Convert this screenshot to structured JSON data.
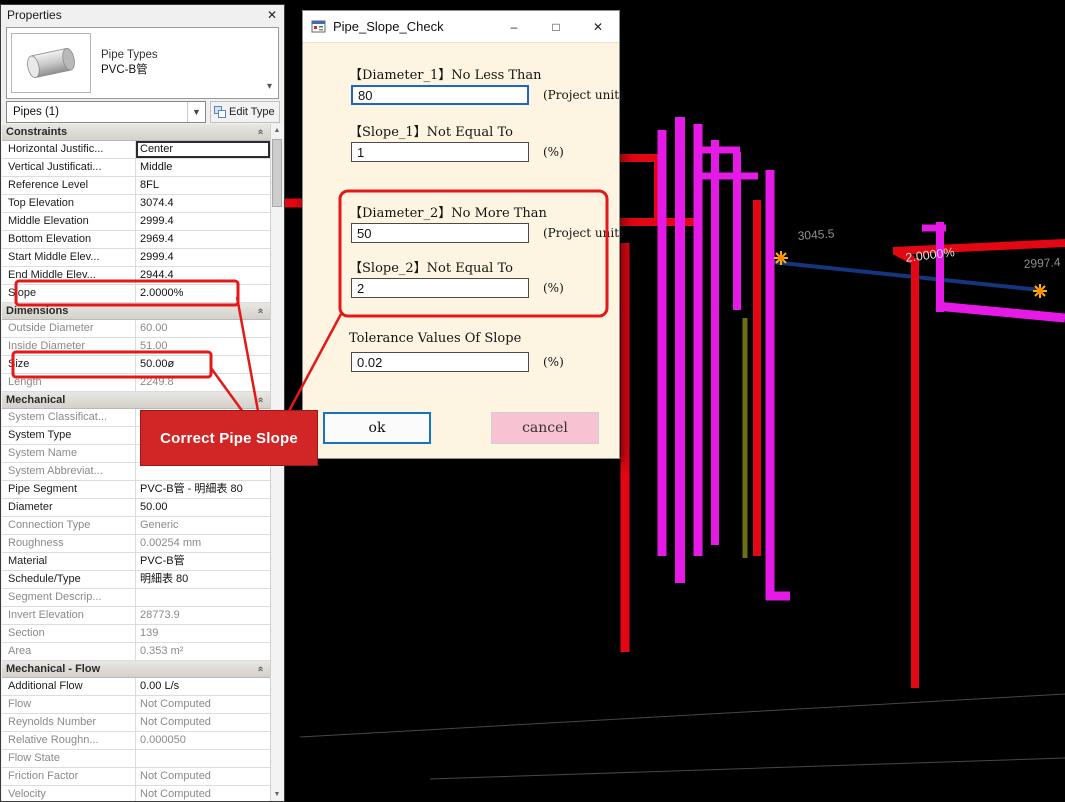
{
  "colors": {
    "accent_red": "#e51818",
    "pipe_magenta": "#e61ae6",
    "pipe_red": "#e30613",
    "pipe_blue": "#16357f",
    "pipe_olive": "#6e6e14",
    "construction": "#474747",
    "label_gray": "#909090",
    "label_white": "#e0e0e0",
    "sun_orange": "#ffb300"
  },
  "viewport": {
    "labels": [
      {
        "text": "3045.5"
      },
      {
        "text": "2.0000%"
      },
      {
        "text": "2997.4"
      }
    ]
  },
  "properties_panel": {
    "title": "Properties",
    "close_glyph": "✕",
    "type_selector": {
      "family": "Pipe Types",
      "type": "PVC-B管"
    },
    "filter_combo": "Pipes (1)",
    "edit_type_label": "Edit Type",
    "sections": [
      {
        "title": "Constraints",
        "rows": [
          {
            "label": "Horizontal Justific...",
            "value": "Center",
            "selected": true
          },
          {
            "label": "Vertical Justificati...",
            "value": "Middle"
          },
          {
            "label": "Reference Level",
            "value": "8FL"
          },
          {
            "label": "Top Elevation",
            "value": "3074.4"
          },
          {
            "label": "Middle Elevation",
            "value": "2999.4"
          },
          {
            "label": "Bottom Elevation",
            "value": "2969.4"
          },
          {
            "label": "Start Middle Elev...",
            "value": "2999.4"
          },
          {
            "label": "End Middle Elev...",
            "value": "2944.4"
          },
          {
            "label": "Slope",
            "value": "2.0000%"
          }
        ]
      },
      {
        "title": "Dimensions",
        "rows": [
          {
            "label": "Outside Diameter",
            "value": "60.00",
            "dim": true
          },
          {
            "label": "Inside Diameter",
            "value": "51.00",
            "dim": true
          },
          {
            "label": "Size",
            "value": "50.00ø"
          },
          {
            "label": "Length",
            "value": "2249.8",
            "dim": true
          }
        ]
      },
      {
        "title": "Mechanical",
        "rows": [
          {
            "label": "System Classificat...",
            "value": "",
            "dim": true
          },
          {
            "label": "System Type",
            "value": ""
          },
          {
            "label": "System Name",
            "value": "",
            "dim": true
          },
          {
            "label": "System Abbreviat...",
            "value": "",
            "dim": true
          },
          {
            "label": "Pipe Segment",
            "value": "PVC-B管 - 明細表 80"
          },
          {
            "label": "Diameter",
            "value": "50.00"
          },
          {
            "label": "Connection Type",
            "value": "Generic",
            "dim": true
          },
          {
            "label": "Roughness",
            "value": "0.00254 mm",
            "dim": true
          },
          {
            "label": "Material",
            "value": "PVC-B管"
          },
          {
            "label": "Schedule/Type",
            "value": "明細表 80"
          },
          {
            "label": "Segment Descrip...",
            "value": "",
            "dim": true
          },
          {
            "label": "Invert Elevation",
            "value": "28773.9",
            "dim": true
          },
          {
            "label": "Section",
            "value": "139",
            "dim": true
          },
          {
            "label": "Area",
            "value": "0.353 m²",
            "dim": true
          }
        ]
      },
      {
        "title": "Mechanical - Flow",
        "rows": [
          {
            "label": "Additional Flow",
            "value": "0.00 L/s"
          },
          {
            "label": "Flow",
            "value": "Not Computed",
            "dim": true
          },
          {
            "label": "Reynolds Number",
            "value": "Not Computed",
            "dim": true
          },
          {
            "label": "Relative Roughn...",
            "value": "0.000050",
            "dim": true
          },
          {
            "label": "Flow State",
            "value": "",
            "dim": true
          },
          {
            "label": "Friction Factor",
            "value": "Not Computed",
            "dim": true
          },
          {
            "label": "Velocity",
            "value": "Not Computed",
            "dim": true
          }
        ]
      }
    ]
  },
  "dialog": {
    "title": "Pipe_Slope_Check",
    "window_buttons": {
      "minimize": "–",
      "maximize": "□",
      "close": "✕"
    },
    "fields": [
      {
        "label": "【Diameter_1】No Less Than",
        "value": "80",
        "unit": "(Project unit)"
      },
      {
        "label": "【Slope_1】Not Equal To",
        "value": "1",
        "unit": "(%)"
      },
      {
        "label": "【Diameter_2】No More Than",
        "value": "50",
        "unit": "(Project unit)"
      },
      {
        "label": "【Slope_2】Not Equal To",
        "value": "2",
        "unit": "(%)"
      },
      {
        "label": "Tolerance Values Of Slope",
        "value": "0.02",
        "unit": "(%)"
      }
    ],
    "ok_label": "ok",
    "cancel_label": "cancel"
  },
  "annotation": {
    "label": "Correct Pipe Slope"
  }
}
